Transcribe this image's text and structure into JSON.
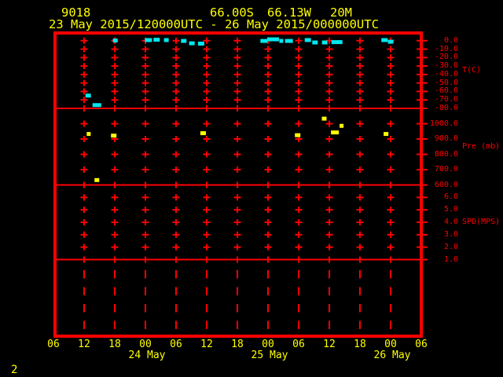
{
  "header": {
    "station_id": "9018",
    "latitude": "66.00S",
    "longitude": "66.13W",
    "elevation": "20M",
    "period": "23 May 2015/120000UTC - 26 May 2015/000000UTC"
  },
  "footer": {
    "page_number": "2"
  },
  "colors": {
    "background": "#000000",
    "grid": "#ff0000",
    "axis_text": "#ff0000",
    "time_text": "#ffff00",
    "temperature_marks": "#00e8ee",
    "pressure_marks": "#ffff00"
  },
  "x_axis": {
    "tick_labels": [
      "06",
      "12",
      "18",
      "00",
      "06",
      "12",
      "18",
      "00",
      "06",
      "12",
      "18",
      "00",
      "06"
    ],
    "tick_interval_hours": 6,
    "start_hour_utc": 6,
    "date_labels": [
      {
        "label": "24 May",
        "tick_index": 3
      },
      {
        "label": "25 May",
        "tick_index": 7
      },
      {
        "label": "26 May",
        "tick_index": 11
      }
    ]
  },
  "chart_data": [
    {
      "type": "scatter",
      "title": "9018  66.00S 66.13W 20M",
      "subtitle": "23 May 2015/120000UTC - 26 May 2015/000000UTC",
      "ylabel": "T(C)",
      "ytick_labels": [
        "0.0",
        "-10.0",
        "-20.0",
        "-30.0",
        "-40.0",
        "-50.0",
        "-60.0",
        "-70.0",
        "-80.0"
      ],
      "ylim_plotted": [
        -80,
        10
      ],
      "x_unit": "hours since 2015-05-23 00UTC",
      "xlim": [
        6,
        78
      ],
      "grid": true,
      "color": "#00e8ee",
      "points": [
        {
          "t": 12.8,
          "v": -64.9,
          "w": 7
        },
        {
          "t": 14.5,
          "v": -76.1,
          "w": 11
        },
        {
          "t": 18.1,
          "v": 0.2,
          "w": 6
        },
        {
          "t": 24.6,
          "v": 0.7,
          "w": 9
        },
        {
          "t": 26.2,
          "v": 1.1,
          "w": 8
        },
        {
          "t": 28.1,
          "v": 0.7,
          "w": 6
        },
        {
          "t": 31.5,
          "v": -0.3,
          "w": 7
        },
        {
          "t": 33.1,
          "v": -3.1,
          "w": 7
        },
        {
          "t": 34.9,
          "v": -3.5,
          "w": 8
        },
        {
          "t": 47.2,
          "v": -0.3,
          "w": 9
        },
        {
          "t": 49.0,
          "v": 1.6,
          "w": 15
        },
        {
          "t": 50.6,
          "v": -0.3,
          "w": 5
        },
        {
          "t": 52.1,
          "v": -0.3,
          "w": 10
        },
        {
          "t": 55.8,
          "v": 0.7,
          "w": 8
        },
        {
          "t": 57.2,
          "v": -2.1,
          "w": 7
        },
        {
          "t": 59.1,
          "v": -2.1,
          "w": 7
        },
        {
          "t": 61.5,
          "v": -1.7,
          "w": 14
        },
        {
          "t": 70.8,
          "v": 0.7,
          "w": 8
        },
        {
          "t": 72.0,
          "v": -1.2,
          "w": 7
        }
      ]
    },
    {
      "type": "scatter",
      "ylabel": "Pre (mb)",
      "ytick_labels": [
        "1000.0",
        "900.0",
        "800.0",
        "700.0",
        "600.0"
      ],
      "ylim_plotted": [
        600,
        1100
      ],
      "x_unit": "hours since 2015-05-23 00UTC",
      "xlim": [
        6,
        78
      ],
      "grid": true,
      "color": "#ffff00",
      "points": [
        {
          "t": 12.9,
          "v": 933,
          "w": 5
        },
        {
          "t": 14.5,
          "v": 632,
          "w": 6
        },
        {
          "t": 17.8,
          "v": 922,
          "w": 7
        },
        {
          "t": 35.3,
          "v": 938,
          "w": 7
        },
        {
          "t": 53.8,
          "v": 925,
          "w": 7
        },
        {
          "t": 59.0,
          "v": 1033,
          "w": 6
        },
        {
          "t": 61.1,
          "v": 943,
          "w": 10
        },
        {
          "t": 62.4,
          "v": 986,
          "w": 5
        },
        {
          "t": 71.1,
          "v": 933,
          "w": 6
        }
      ]
    },
    {
      "type": "scatter",
      "ylabel": "SPD(MPS)",
      "ytick_labels": [
        "6.0",
        "5.0",
        "4.0",
        "3.0",
        "2.0",
        "1.0"
      ],
      "ylim_plotted": [
        1,
        7
      ],
      "x_unit": "hours since 2015-05-23 00UTC",
      "xlim": [
        6,
        78
      ],
      "grid": true,
      "points": []
    },
    {
      "type": "scatter",
      "ylabel": "",
      "ytick_labels": [],
      "ylim_plotted": null,
      "x_unit": "hours since 2015-05-23 00UTC",
      "xlim": [
        6,
        78
      ],
      "grid": true,
      "points": []
    }
  ]
}
